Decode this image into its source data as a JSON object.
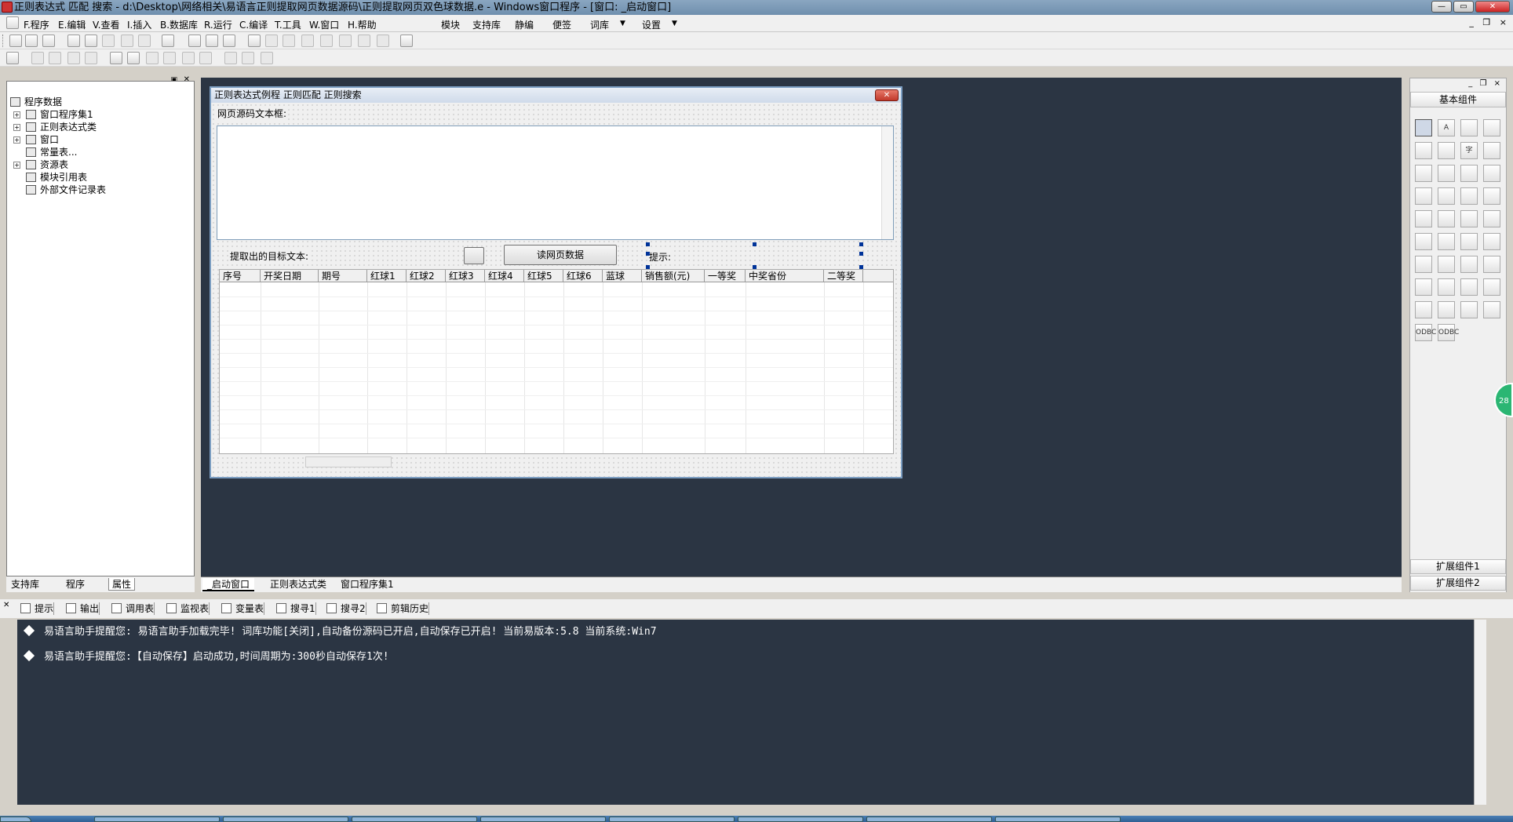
{
  "title": "正则表达式 匹配 搜索 - d:\\Desktop\\网络相关\\易语言正则提取网页数据源码\\正则提取网页双色球数据.e - Windows窗口程序 - [窗口: _启动窗口]",
  "window_buttons": {
    "minimize": "—",
    "restore": "▭",
    "close": "✕"
  },
  "menu": {
    "items": [
      "F.程序",
      "E.编辑",
      "V.查看",
      "I.插入",
      "B.数据库",
      "R.运行",
      "C.编译",
      "T.工具",
      "W.窗口",
      "H.帮助"
    ],
    "right_items": [
      "模块",
      "支持库",
      "静编",
      "便签",
      "词库",
      "设置"
    ],
    "dropdown_arrow": "▼",
    "mdi_buttons": "_ ❐ ×"
  },
  "tree": {
    "root": "程序数据",
    "items": [
      "窗口程序集1",
      "正则表达式类",
      "窗口",
      "常量表...",
      "资源表",
      "模块引用表",
      "外部文件记录表"
    ],
    "expand_symbol": "+"
  },
  "left_tabs": [
    "支持库",
    "程序",
    "属性"
  ],
  "form": {
    "title": "正则表达式例程 正则匹配 正则搜索",
    "close_label": "✕",
    "source_label": "网页源码文本框:",
    "target_label": "提取出的目标文本:",
    "read_button": "读网页数据",
    "hint_label": "提示:",
    "columns": [
      "序号",
      "开奖日期",
      "期号",
      "红球1",
      "红球2",
      "红球3",
      "红球4",
      "红球5",
      "红球6",
      "蓝球",
      "销售额(元)",
      "一等奖",
      "中奖省份",
      "二等奖"
    ]
  },
  "components": {
    "header": "基本组件",
    "footer1": "扩展组件1",
    "footer2": "扩展组件2",
    "icons": [
      "pointer-icon",
      "label-icon",
      "picture-icon",
      "shape-icon",
      "edit-icon",
      "frame-icon",
      "text-icon",
      "line-icon",
      "checkbox-icon",
      "radio-icon",
      "combobox-icon",
      "listbox-icon",
      "list-icon",
      "hscroll-icon",
      "vscroll-icon",
      "progress-icon",
      "slider-icon",
      "tab-icon",
      "calendar-icon",
      "button-icon",
      "folder-icon",
      "grid-icon",
      "tree-icon",
      "image-icon",
      "spin-icon",
      "timer-icon",
      "printer-icon",
      "network-icon",
      "client-icon",
      "server-icon",
      "port-icon",
      "table-icon",
      "data-icon",
      "db-icon",
      "db2-icon",
      "chart-icon",
      "odbc-icon",
      "odbc2-icon"
    ],
    "labels": {
      "odbc": "ODBC",
      "font": "字",
      "label": "A"
    }
  },
  "doc_tabs": [
    "_启动窗口",
    "正则表达式类",
    "窗口程序集1"
  ],
  "output_tabs": [
    "提示",
    "输出",
    "调用表",
    "监视表",
    "变量表",
    "搜寻1",
    "搜寻2",
    "剪辑历史"
  ],
  "output_lines": [
    "易语言助手提醒您:  易语言助手加载完毕!  词库功能[关闭],自动备份源码已开启,自动保存已开启!  当前易版本:5.8  当前系统:Win7",
    "易语言助手提醒您:【自动保存】启动成功,时间周期为:300秒自动保存1次!"
  ],
  "float_badge": "28",
  "colors": {
    "workspace": "#2b3543",
    "titlebar": "#7f9dbb",
    "accent": "#003399"
  }
}
